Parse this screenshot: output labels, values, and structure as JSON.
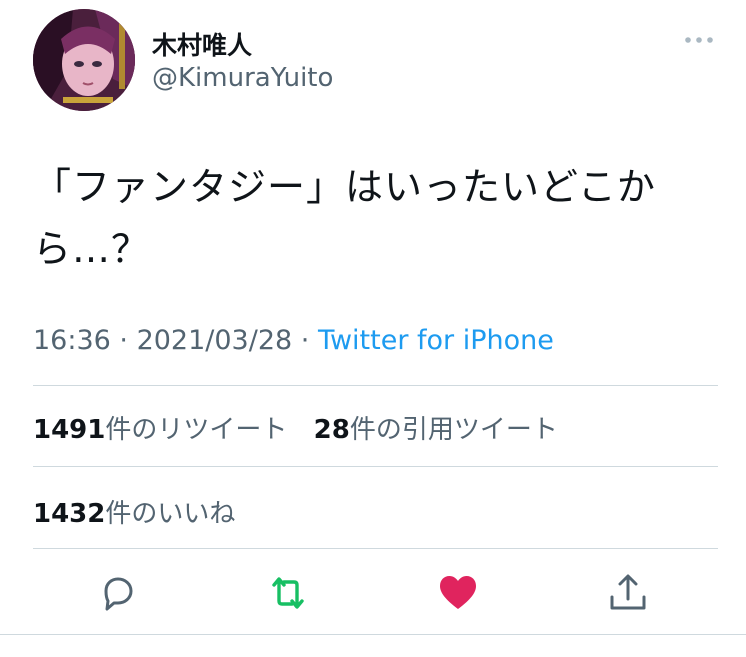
{
  "user": {
    "display_name": "木村唯人",
    "handle": "@KimuraYuito"
  },
  "tweet": {
    "text": "「ファンタジー」はいったいどこから…？",
    "time": "16:36",
    "separator": " · ",
    "date": "2021/03/28",
    "source": "Twitter for iPhone"
  },
  "stats": {
    "retweets_count": "1491",
    "retweets_label": "件のリツイート",
    "quotes_count": "28",
    "quotes_label": "件の引用ツイート",
    "likes_count": "1432",
    "likes_label": "件のいいね"
  },
  "actions": {
    "reply_icon": "speech-bubble",
    "retweet_icon": "retweet-arrows",
    "like_icon": "heart",
    "share_icon": "share-arrow-up"
  },
  "colors": {
    "text": "#0f1419",
    "muted": "#536471",
    "link": "#1d9bf0",
    "retweet_active": "#17bf63",
    "like_active": "#e0245e",
    "divider": "#cfd9de"
  }
}
